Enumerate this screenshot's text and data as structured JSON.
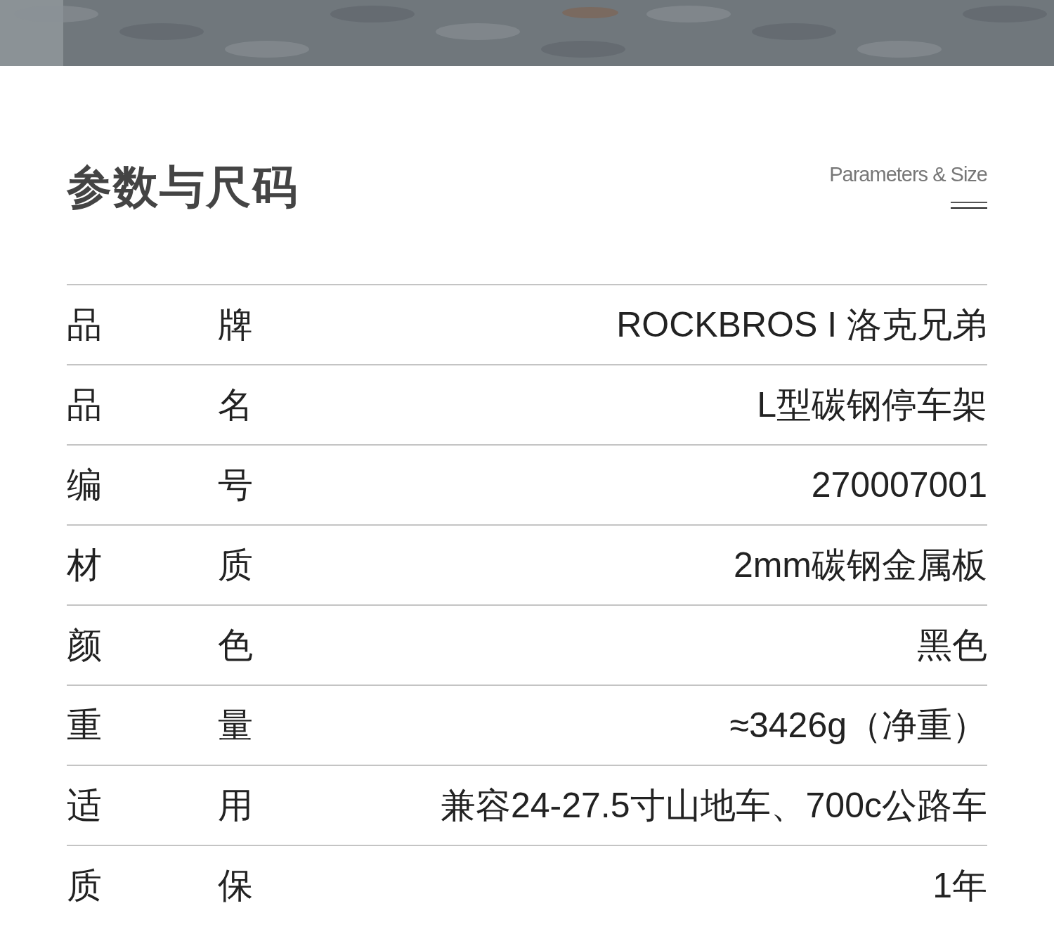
{
  "heading": {
    "title": "参数与尺码",
    "subtitle": "Parameters & Size"
  },
  "specs": [
    {
      "label_1": "品",
      "label_2": "牌",
      "value": "ROCKBROS I 洛克兄弟"
    },
    {
      "label_1": "品",
      "label_2": "名",
      "value": "L型碳钢停车架"
    },
    {
      "label_1": "编",
      "label_2": "号",
      "value": "270007001"
    },
    {
      "label_1": "材",
      "label_2": "质",
      "value": "2mm碳钢金属板"
    },
    {
      "label_1": "颜",
      "label_2": "色",
      "value": "黑色"
    },
    {
      "label_1": "重",
      "label_2": "量",
      "value": "≈3426g（净重）"
    },
    {
      "label_1": "适",
      "label_2": "用",
      "value": "兼容24-27.5寸山地车、700c公路车"
    },
    {
      "label_1": "质",
      "label_2": "保",
      "value": "1年"
    }
  ]
}
